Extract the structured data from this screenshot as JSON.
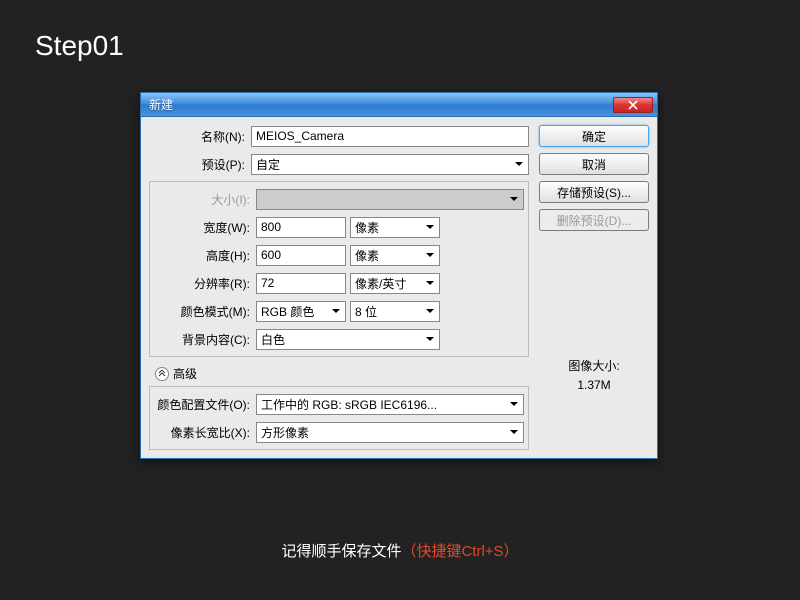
{
  "step_label": "Step01",
  "dialog": {
    "title": "新建",
    "fields": {
      "name_label": "名称(N):",
      "name_value": "MEIOS_Camera",
      "preset_label": "预设(P):",
      "preset_value": "自定",
      "size_label": "大小(I):",
      "width_label": "宽度(W):",
      "width_value": "800",
      "width_unit": "像素",
      "height_label": "高度(H):",
      "height_value": "600",
      "height_unit": "像素",
      "res_label": "分辨率(R):",
      "res_value": "72",
      "res_unit": "像素/英寸",
      "mode_label": "颜色模式(M):",
      "mode_value": "RGB 颜色",
      "depth_value": "8 位",
      "bg_label": "背景内容(C):",
      "bg_value": "白色",
      "profile_label": "颜色配置文件(O):",
      "profile_value": "工作中的 RGB: sRGB IEC6196...",
      "aspect_label": "像素长宽比(X):",
      "aspect_value": "方形像素"
    },
    "advanced_label": "高级",
    "buttons": {
      "ok": "确定",
      "cancel": "取消",
      "save_preset": "存储预设(S)...",
      "delete_preset": "删除预设(D)..."
    },
    "info": {
      "size_label": "图像大小:",
      "size_value": "1.37M"
    }
  },
  "footer": {
    "text1": "记得顺手保存文件",
    "text2": "（快捷键Ctrl+S）"
  }
}
